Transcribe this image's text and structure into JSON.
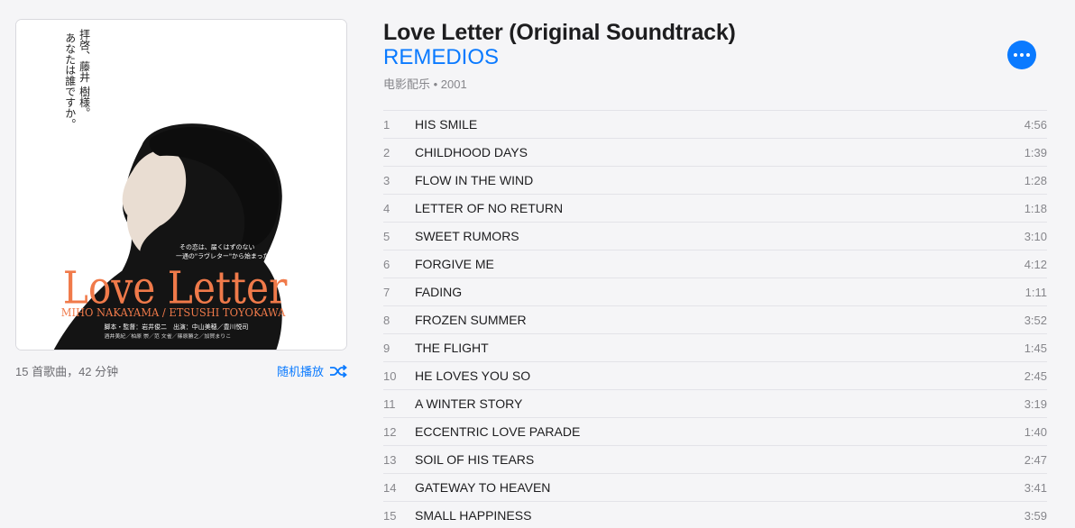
{
  "album": {
    "title": "Love Letter (Original Soundtrack)",
    "artist": "REMEDIOS",
    "genre_year": "电影配乐 • 2001",
    "summary": "15 首歌曲，42 分钟",
    "shuffle_label": "随机播放",
    "accent_color": "#0a7aff"
  },
  "artwork": {
    "vertical_text_1": "拝啓、藤井 樹様。",
    "vertical_text_2": "あなたは誰ですか。",
    "tagline_1": "その恋は、届くはずのない",
    "tagline_2": "一通の\"ラヴレター\"から始まった。",
    "logo": "Love Letter",
    "cast": "MIHO NAKAYAMA / ETSUSHI TOYOKAWA",
    "credits_1": "脚本・監督：岩井俊二　出演：中山美穂／豊川悦司",
    "credits_2": "酒井美紀／柏原 崇／范 文雀／篠原勝之／加賀まりこ"
  },
  "tracks": [
    {
      "num": "1",
      "name": "HIS SMILE",
      "duration": "4:56"
    },
    {
      "num": "2",
      "name": "CHILDHOOD DAYS",
      "duration": "1:39"
    },
    {
      "num": "3",
      "name": "FLOW IN THE WIND",
      "duration": "1:28"
    },
    {
      "num": "4",
      "name": "LETTER OF NO RETURN",
      "duration": "1:18"
    },
    {
      "num": "5",
      "name": "SWEET RUMORS",
      "duration": "3:10"
    },
    {
      "num": "6",
      "name": "FORGIVE ME",
      "duration": "4:12"
    },
    {
      "num": "7",
      "name": "FADING",
      "duration": "1:11"
    },
    {
      "num": "8",
      "name": "FROZEN SUMMER",
      "duration": "3:52"
    },
    {
      "num": "9",
      "name": "THE FLIGHT",
      "duration": "1:45"
    },
    {
      "num": "10",
      "name": "HE LOVES YOU SO",
      "duration": "2:45"
    },
    {
      "num": "11",
      "name": "A WINTER STORY",
      "duration": "3:19"
    },
    {
      "num": "12",
      "name": "ECCENTRIC LOVE PARADE",
      "duration": "1:40"
    },
    {
      "num": "13",
      "name": "SOIL OF HIS TEARS",
      "duration": "2:47"
    },
    {
      "num": "14",
      "name": "GATEWAY TO HEAVEN",
      "duration": "3:41"
    },
    {
      "num": "15",
      "name": "SMALL HAPPINESS",
      "duration": "3:59"
    }
  ]
}
